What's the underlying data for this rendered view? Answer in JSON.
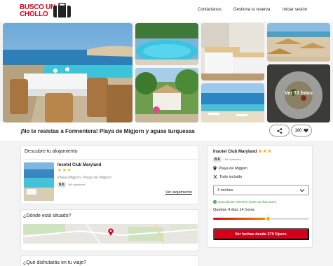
{
  "header": {
    "logo_line1": "BUSCO UN",
    "logo_line2": "CHOLLO",
    "nav": [
      "Contáctanos",
      "Gestiona tu reserva",
      "Iniciar sesión"
    ]
  },
  "gallery": {
    "more_photos_label": "Ver 33 fotos"
  },
  "title": "¡No te resistas a Formentera! Playa de Migjorn y aguas turquesas",
  "like_count": "160",
  "accommodation": {
    "section_title": "Descubre tu alojamiento",
    "hotel_name": "Insotel Club Maryland",
    "stars": 3,
    "stars_text": "★★★",
    "location": "Playa Migjorn, Playa de Migjorn",
    "score": "8.6",
    "opinions": "164 opiniones",
    "link": "Ver alojamiento"
  },
  "location_section": {
    "title": "¿Dónde está situado?"
  },
  "enjoy_section": {
    "title": "¿Qué disfrutarás en tu viaje?"
  },
  "booking": {
    "hotel_name": "Insotel Club Maryland",
    "stars": 3,
    "stars_text": "★★★",
    "score": "8.6",
    "opinions": "164 opiniones",
    "location": "Playa de Migjorn",
    "board": "Todo incluido",
    "nights_selected": "3 noches",
    "cancellation": "Cancelación GRATIS hasta 13 días antes",
    "remaining": "Quedan 4 días 14 horas",
    "remaining_progress": 0.57,
    "cta": "Ver fechas desde 279 €/pers."
  },
  "colors": {
    "brand_red": "#e3001b",
    "cta_red": "#d4001a",
    "star_yellow": "#f3b100",
    "cancel_green": "#2e9b3a"
  },
  "icons": [
    "suitcase-icon",
    "share-icon",
    "heart-icon",
    "location-pin-icon",
    "cutlery-icon",
    "chevron-down-icon",
    "check-circle-icon",
    "map-marker-icon"
  ]
}
